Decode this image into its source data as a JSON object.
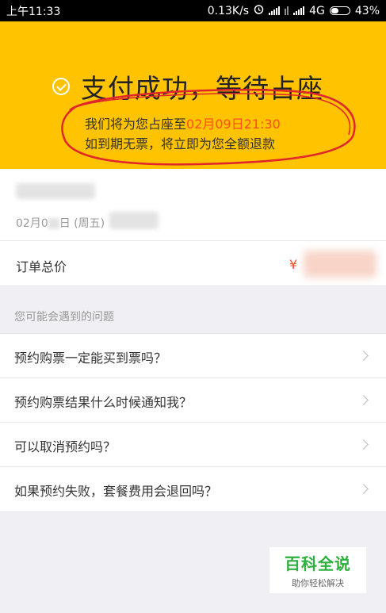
{
  "status_bar": {
    "time": "上午11:33",
    "speed": "0.13K/s",
    "network": "4G",
    "battery": "43%",
    "battery_level": 0.43
  },
  "header": {
    "title": "支付成功，等待占座",
    "notice_prefix": "我们将为您占座至",
    "deadline": "02月09日21:30",
    "notice_line2": "如到期无票，将立即为您全额退款",
    "background": "#ffc300",
    "highlight_color": "#ff4d1f"
  },
  "ticket": {
    "date_prefix": "02月0",
    "date_suffix": "日 (周五)"
  },
  "order": {
    "label": "订单总价",
    "currency": "¥"
  },
  "faq": {
    "heading": "您可能会遇到的问题",
    "items": [
      {
        "question": "预约购票一定能买到票吗？"
      },
      {
        "question": "预约购票结果什么时候通知我？"
      },
      {
        "question": "可以取消预约吗？"
      },
      {
        "question": "如果预约失败，套餐费用会退回吗？"
      }
    ]
  },
  "watermark": {
    "main": "百科全说",
    "sub": "助你轻松解决"
  }
}
